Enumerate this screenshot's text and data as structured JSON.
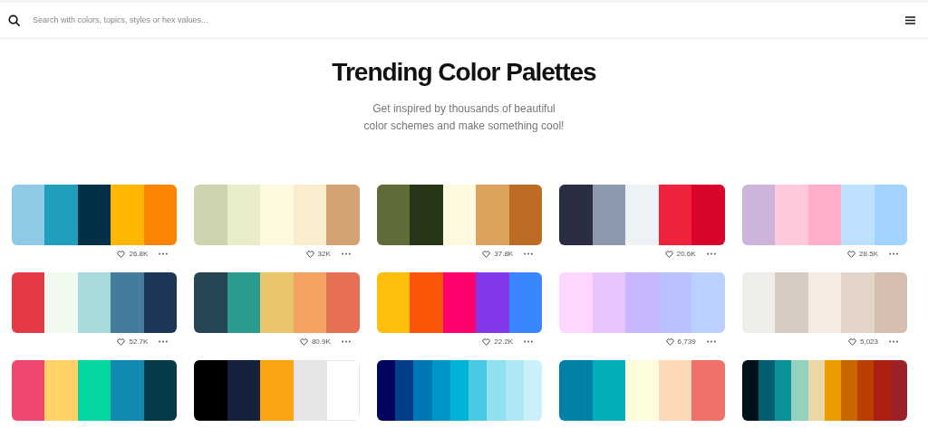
{
  "search": {
    "placeholder": "Search with colors, topics, styles or hex values..."
  },
  "hero": {
    "title": "Trending Color Palettes",
    "subtitle_lines": [
      "Get inspired by thousands of beautiful",
      "color schemes and make something cool!"
    ]
  },
  "palettes": [
    {
      "swatches": [
        {
          "color": "#8ecae6"
        },
        {
          "color": "#219ebc"
        },
        {
          "color": "#023047"
        },
        {
          "color": "#ffb703"
        },
        {
          "color": "#fb8500"
        }
      ],
      "likes": "26.8K"
    },
    {
      "swatches": [
        {
          "color": "#ccd5ae"
        },
        {
          "color": "#e9edc9"
        },
        {
          "color": "#fefae0"
        },
        {
          "color": "#faedcd"
        },
        {
          "color": "#d4a373"
        }
      ],
      "likes": "32K"
    },
    {
      "swatches": [
        {
          "color": "#606c38"
        },
        {
          "color": "#283618"
        },
        {
          "color": "#fefae0"
        },
        {
          "color": "#dda15e"
        },
        {
          "color": "#bc6c25"
        }
      ],
      "likes": "37.8K"
    },
    {
      "swatches": [
        {
          "color": "#2b2d42"
        },
        {
          "color": "#8d99ae"
        },
        {
          "color": "#edf2f4"
        },
        {
          "color": "#ef233c"
        },
        {
          "color": "#d90429"
        }
      ],
      "likes": "20.6K"
    },
    {
      "swatches": [
        {
          "color": "#cdb4db"
        },
        {
          "color": "#ffc8dd"
        },
        {
          "color": "#ffafcc"
        },
        {
          "color": "#bde0fe"
        },
        {
          "color": "#a2d2ff"
        }
      ],
      "likes": "28.5K"
    },
    {
      "swatches": [
        {
          "color": "#e63946"
        },
        {
          "color": "#f1faee"
        },
        {
          "color": "#a8dadc"
        },
        {
          "color": "#457b9d"
        },
        {
          "color": "#1d3557"
        }
      ],
      "likes": "52.7K"
    },
    {
      "swatches": [
        {
          "color": "#264653"
        },
        {
          "color": "#2a9d8f"
        },
        {
          "color": "#e9c46a"
        },
        {
          "color": "#f4a261"
        },
        {
          "color": "#e76f51"
        }
      ],
      "likes": "80.9K"
    },
    {
      "swatches": [
        {
          "color": "#ffbe0b"
        },
        {
          "color": "#fb5607"
        },
        {
          "color": "#ff006e"
        },
        {
          "color": "#8338ec"
        },
        {
          "color": "#3a86ff"
        }
      ],
      "likes": "22.2K"
    },
    {
      "swatches": [
        {
          "color": "#ffd6ff"
        },
        {
          "color": "#e7c6ff"
        },
        {
          "color": "#c8b6ff"
        },
        {
          "color": "#b8c0ff"
        },
        {
          "color": "#bbd0ff"
        }
      ],
      "likes": "6,739"
    },
    {
      "swatches": [
        {
          "color": "#edede9"
        },
        {
          "color": "#d6ccc2"
        },
        {
          "color": "#f5ebe0"
        },
        {
          "color": "#e3d5ca"
        },
        {
          "color": "#d5bdaf"
        }
      ],
      "likes": "5,023"
    },
    {
      "swatches": [
        {
          "color": "#ef476f"
        },
        {
          "color": "#ffd166"
        },
        {
          "color": "#06d6a0"
        },
        {
          "color": "#118ab2"
        },
        {
          "color": "#073b4c"
        }
      ]
    },
    {
      "swatches": [
        {
          "color": "#000000"
        },
        {
          "color": "#14213d"
        },
        {
          "color": "#fca311"
        },
        {
          "color": "#e5e5e5"
        },
        {
          "color": "#ffffff"
        }
      ]
    },
    {
      "swatches": [
        {
          "color": "#03045e"
        },
        {
          "color": "#023e8a"
        },
        {
          "color": "#0077b6"
        },
        {
          "color": "#0096c7"
        },
        {
          "color": "#00b4d8"
        },
        {
          "color": "#48cae4"
        },
        {
          "color": "#90e0ef"
        },
        {
          "color": "#ade8f4"
        },
        {
          "color": "#caf0f8"
        }
      ]
    },
    {
      "swatches": [
        {
          "color": "#0081a7"
        },
        {
          "color": "#00afb9"
        },
        {
          "color": "#fdfcdc"
        },
        {
          "color": "#fed9b7"
        },
        {
          "color": "#f07167"
        }
      ]
    },
    {
      "swatches": [
        {
          "color": "#001219"
        },
        {
          "color": "#005f73"
        },
        {
          "color": "#0a9396"
        },
        {
          "color": "#94d2bd"
        },
        {
          "color": "#e9d8a6"
        },
        {
          "color": "#ee9b00"
        },
        {
          "color": "#ca6702"
        },
        {
          "color": "#bb3e03"
        },
        {
          "color": "#ae2012"
        },
        {
          "color": "#9b2226"
        }
      ]
    }
  ]
}
